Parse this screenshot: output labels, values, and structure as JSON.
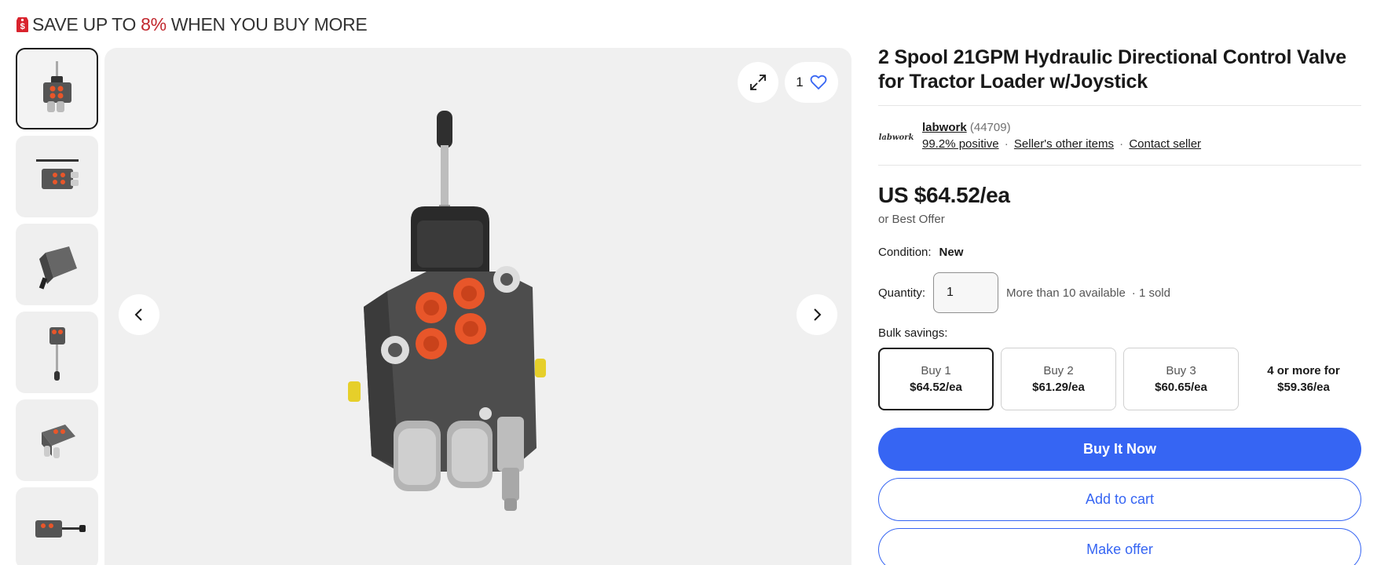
{
  "banner": {
    "pre": "SAVE UP TO",
    "percent": "8%",
    "post": "WHEN YOU BUY MORE",
    "icon": "discount-tag-icon"
  },
  "gallery": {
    "thumbnail_count": 6,
    "active_index": 0,
    "watch_count": "1",
    "icons": [
      "expand-icon",
      "heart-icon",
      "chevron-left-icon",
      "chevron-right-icon"
    ]
  },
  "product": {
    "title": "2 Spool 21GPM Hydraulic Directional Control Valve for Tractor Loader w/Joystick"
  },
  "seller": {
    "logo_text": "labwork",
    "name": "labwork",
    "feedback_count": "(44709)",
    "positive": "99.2% positive",
    "other_items": "Seller's other items",
    "contact": "Contact seller",
    "separator": "·"
  },
  "pricing": {
    "price": "US $64.52/ea",
    "best_offer": "or Best Offer"
  },
  "condition": {
    "label": "Condition:",
    "value": "New"
  },
  "quantity": {
    "label": "Quantity:",
    "value": "1",
    "available": "More than 10 available",
    "sold": "· 1 sold"
  },
  "bulk": {
    "label": "Bulk savings:",
    "options": [
      {
        "qty": "Buy 1",
        "price": "$64.52/ea"
      },
      {
        "qty": "Buy 2",
        "price": "$61.29/ea"
      },
      {
        "qty": "Buy 3",
        "price": "$60.65/ea"
      },
      {
        "qty": "4 or more for",
        "price": "$59.36/ea"
      }
    ]
  },
  "actions": {
    "buy_now": "Buy It Now",
    "add_to_cart": "Add to cart",
    "make_offer": "Make offer"
  },
  "colors": {
    "primary": "#3665f3",
    "sale_red": "#c1272d",
    "valve_body": "#4a4a4a",
    "port_orange": "#e8562a"
  }
}
